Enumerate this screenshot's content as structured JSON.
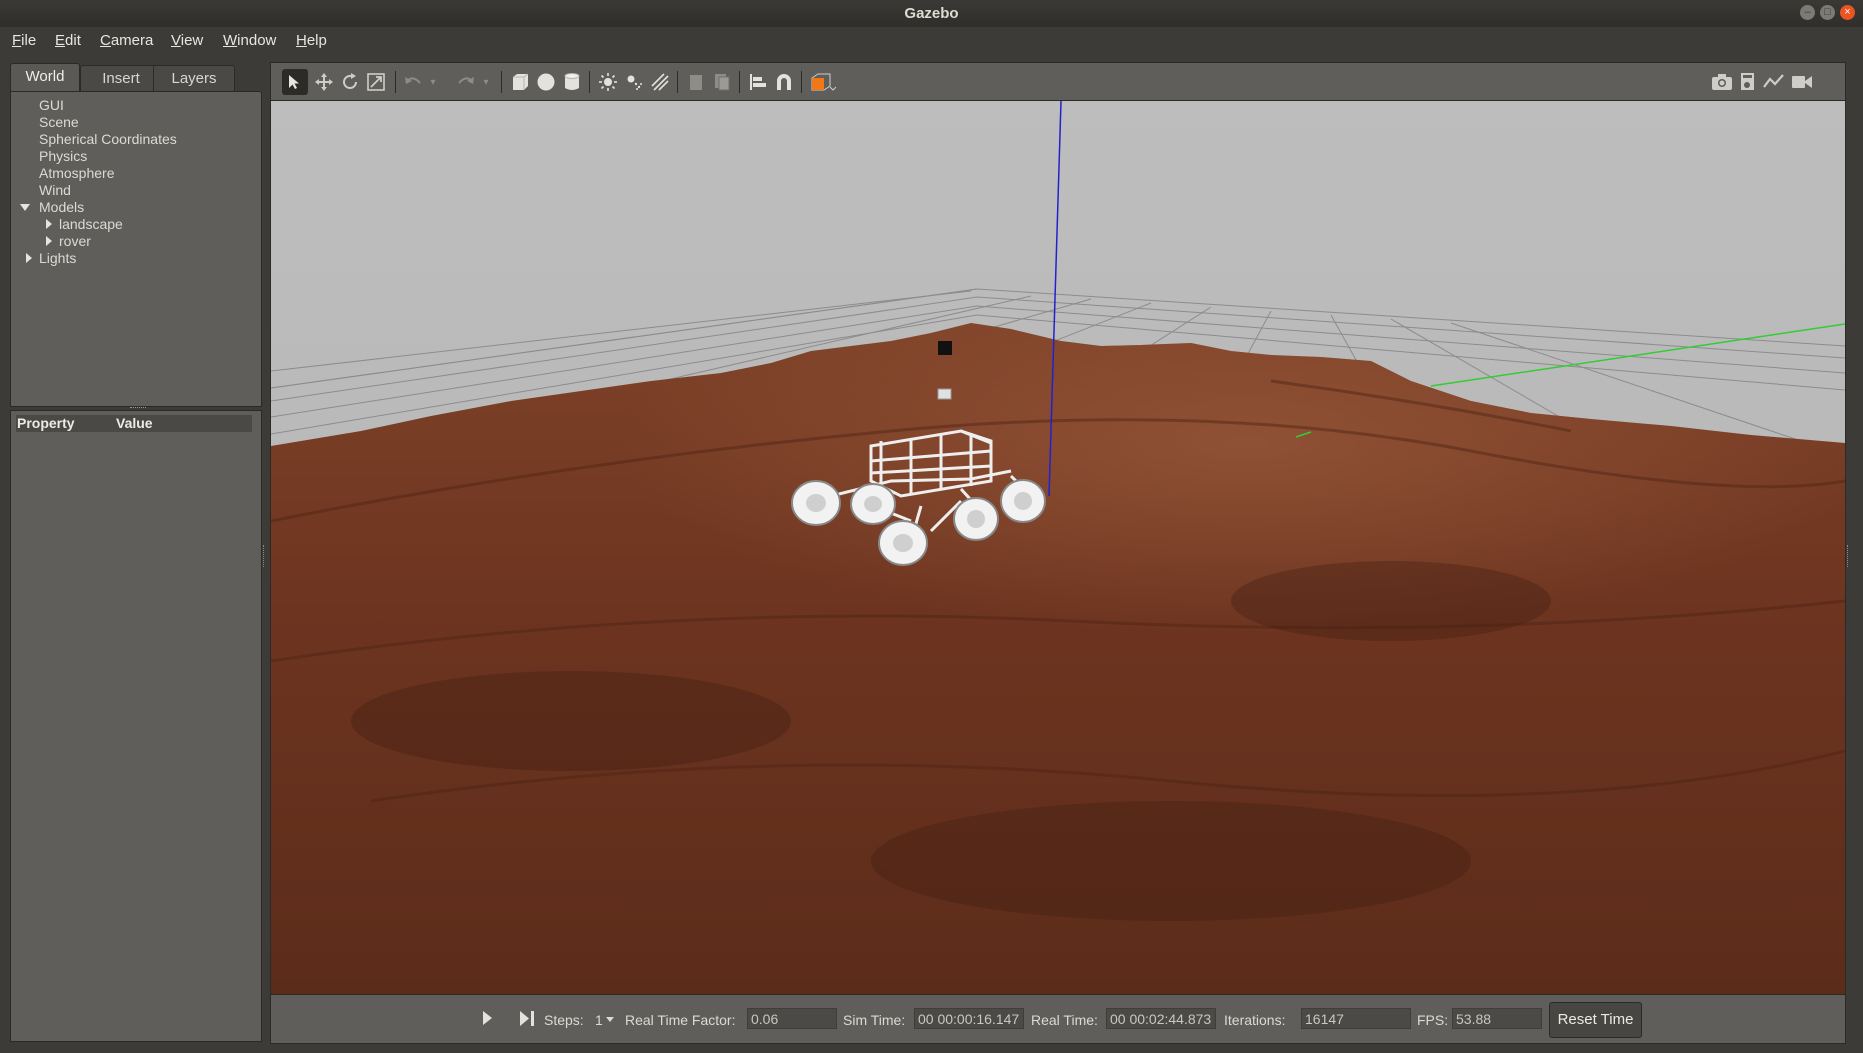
{
  "window": {
    "title": "Gazebo"
  },
  "menu": [
    {
      "u": "F",
      "rest": "ile"
    },
    {
      "u": "E",
      "rest": "dit"
    },
    {
      "u": "C",
      "rest": "amera"
    },
    {
      "u": "V",
      "rest": "iew"
    },
    {
      "u": "W",
      "rest": "indow"
    },
    {
      "u": "H",
      "rest": "elp"
    }
  ],
  "tabs": [
    "World",
    "Insert",
    "Layers"
  ],
  "tree": {
    "gui": "GUI",
    "scene": "Scene",
    "spherical": "Spherical Coordinates",
    "physics": "Physics",
    "atmosphere": "Atmosphere",
    "wind": "Wind",
    "models": "Models",
    "landscape": "landscape",
    "rover": "rover",
    "lights": "Lights"
  },
  "props": {
    "property": "Property",
    "value": "Value"
  },
  "toolbar_icons": [
    "select-icon",
    "translate-icon",
    "rotate-icon",
    "scale-icon",
    "undo-icon",
    "undo-history-icon",
    "redo-icon",
    "redo-history-icon",
    "box-icon",
    "sphere-icon",
    "cylinder-icon",
    "point-light-icon",
    "spot-light-icon",
    "directional-light-icon",
    "copy-icon",
    "paste-icon",
    "align-icon",
    "snap-icon",
    "view-angle-icon",
    "screenshot-icon",
    "log-icon",
    "plot-icon",
    "record-video-icon"
  ],
  "bottom": {
    "steps_label": "Steps:",
    "steps_value": "1",
    "rtf_label": "Real Time Factor:",
    "rtf_value": "0.06",
    "sim_label": "Sim Time:",
    "sim_value": "00 00:00:16.147",
    "real_label": "Real Time:",
    "real_value": "00 00:02:44.873",
    "iter_label": "Iterations:",
    "iter_value": "16147",
    "fps_label": "FPS:",
    "fps_value": "53.88",
    "reset_label": "Reset Time"
  },
  "colors": {
    "accent": "#e95420",
    "terrain": "#7a3d22",
    "sky": "#bdbdbd",
    "z_axis": "#2222cc",
    "y_axis": "#33cc33"
  }
}
